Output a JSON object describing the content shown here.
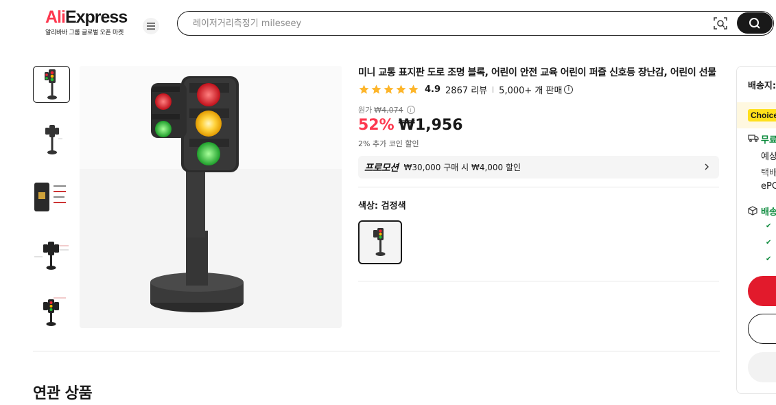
{
  "header": {
    "logo_text_a": "Ali",
    "logo_text_b": "Express",
    "logo_tagline": "알리바바 그룹 글로벌 오픈 마켓",
    "search_placeholder": "레이저거리측정기 mileseey"
  },
  "product": {
    "title": "미니 교통 표지판 도로 조명 블록, 어린이 안전 교육 어린이 퍼즐 신호등 장난감, 어린이 선물",
    "rating": "4.9",
    "reviews": "2867 리뷰",
    "sold": "5,000+ 개 판매",
    "original_price_label": "원가",
    "original_price": "₩4,074",
    "discount": "52%",
    "price": "₩1,956",
    "coin_discount": "2% 추가 코인 할인",
    "promotion_label": "프로모션",
    "promotion_text": "₩30,000 구매 시 ₩4,000 할인",
    "color_label": "색상: 검정색"
  },
  "shipping_panel": {
    "label": "배송지:",
    "choice_badge": "Choice",
    "free_shipping": "무료",
    "estimate": "예상",
    "courier": "택배",
    "carrier": "ePC",
    "delivery_promise": "배송",
    "checks": [
      "✔",
      "✔",
      "✔"
    ]
  },
  "related": {
    "heading": "연관 상품"
  },
  "colors": {
    "accent_red": "#fd384f",
    "buy_button": "#e21a2c",
    "choice_yellow": "#ffe01b",
    "green": "#0b8a3c"
  }
}
